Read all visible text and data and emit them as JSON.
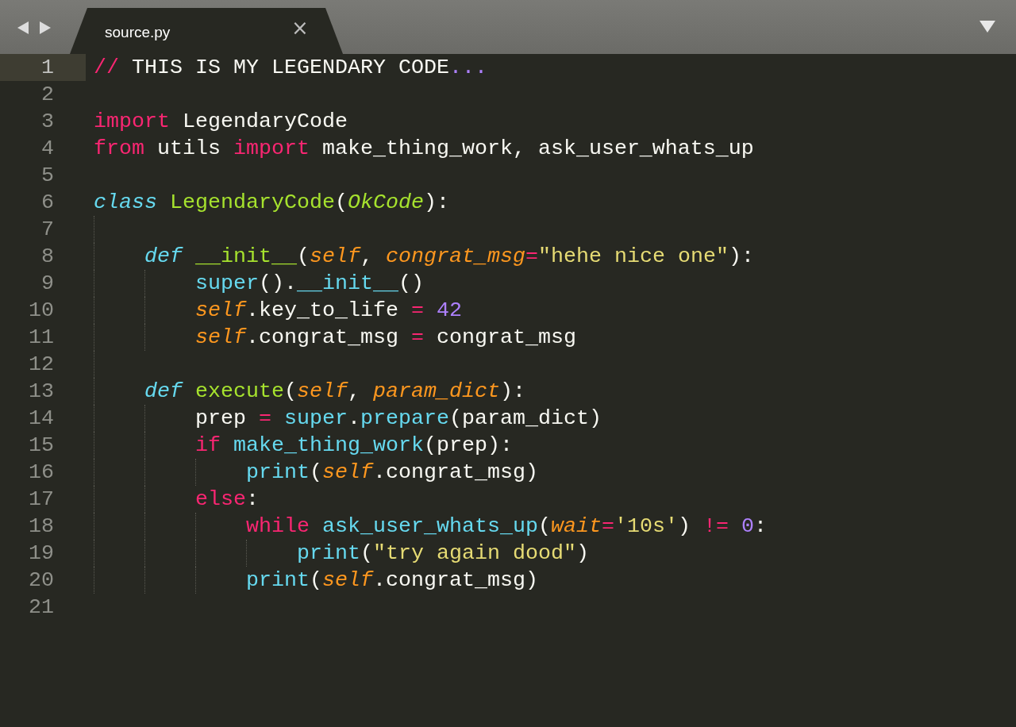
{
  "tab": {
    "title": "source.py",
    "close": "×",
    "selected": true
  },
  "lines": [
    {
      "number": "1",
      "current": true,
      "tokens": [
        {
          "kind": "keyword",
          "text": "//"
        },
        {
          "kind": "plain",
          "text": " THIS IS MY LEGENDARY CODE"
        },
        {
          "kind": "number",
          "text": "..."
        }
      ]
    },
    {
      "number": "2",
      "current": false
    },
    {
      "number": "3",
      "current": false,
      "tokens": [
        {
          "kind": "keyword",
          "text": "import"
        },
        {
          "kind": "plain",
          "text": " LegendaryCode"
        }
      ]
    },
    {
      "number": "4",
      "current": false,
      "tokens": [
        {
          "kind": "keyword",
          "text": "from"
        },
        {
          "kind": "plain",
          "text": " utils "
        },
        {
          "kind": "keyword",
          "text": "import"
        },
        {
          "kind": "plain",
          "text": " make_thing_work, ask_user_whats_up"
        }
      ]
    },
    {
      "number": "5",
      "current": false
    },
    {
      "number": "6",
      "current": false,
      "tokens": [
        {
          "kind": "storage",
          "text": "class "
        },
        {
          "kind": "type",
          "text": "LegendaryCode"
        },
        {
          "kind": "plain",
          "text": "("
        },
        {
          "kind": "inherited",
          "text": "OkCode"
        },
        {
          "kind": "plain",
          "text": "):"
        }
      ],
      "children": [
        {
          "number": "7",
          "current": false
        },
        {
          "number": "8",
          "current": false,
          "tokens": [
            {
              "kind": "storage",
              "text": "def "
            },
            {
              "kind": "type",
              "text": "__init__"
            },
            {
              "kind": "plain",
              "text": "("
            },
            {
              "kind": "param",
              "text": "self"
            },
            {
              "kind": "plain",
              "text": ", "
            },
            {
              "kind": "param",
              "text": "congrat_msg"
            },
            {
              "kind": "operator",
              "text": "="
            },
            {
              "kind": "string",
              "text": "\"hehe nice one\""
            },
            {
              "kind": "plain",
              "text": "):"
            }
          ],
          "children": [
            {
              "number": "9",
              "current": false,
              "tokens": [
                {
                  "kind": "support",
                  "text": "super"
                },
                {
                  "kind": "plain",
                  "text": "()."
                },
                {
                  "kind": "support",
                  "text": "__init__"
                },
                {
                  "kind": "plain",
                  "text": "()"
                }
              ]
            },
            {
              "number": "10",
              "current": false,
              "tokens": [
                {
                  "kind": "param",
                  "text": "self"
                },
                {
                  "kind": "plain",
                  "text": ".key_to_life "
                },
                {
                  "kind": "operator",
                  "text": "= "
                },
                {
                  "kind": "number",
                  "text": "42"
                }
              ]
            },
            {
              "number": "11",
              "current": false,
              "tokens": [
                {
                  "kind": "param",
                  "text": "self"
                },
                {
                  "kind": "plain",
                  "text": ".congrat_msg "
                },
                {
                  "kind": "operator",
                  "text": "="
                },
                {
                  "kind": "plain",
                  "text": " congrat_msg"
                }
              ]
            }
          ]
        },
        {
          "number": "12",
          "current": false
        },
        {
          "number": "13",
          "current": false,
          "tokens": [
            {
              "kind": "storage",
              "text": "def "
            },
            {
              "kind": "type",
              "text": "execute"
            },
            {
              "kind": "plain",
              "text": "("
            },
            {
              "kind": "param",
              "text": "self"
            },
            {
              "kind": "plain",
              "text": ", "
            },
            {
              "kind": "param",
              "text": "param_dict"
            },
            {
              "kind": "plain",
              "text": "):"
            }
          ],
          "children": [
            {
              "number": "14",
              "current": false,
              "tokens": [
                {
                  "kind": "plain",
                  "text": "prep "
                },
                {
                  "kind": "operator",
                  "text": "= "
                },
                {
                  "kind": "support",
                  "text": "super"
                },
                {
                  "kind": "plain",
                  "text": "."
                },
                {
                  "kind": "support",
                  "text": "prepare"
                },
                {
                  "kind": "plain",
                  "text": "(param_dict)"
                }
              ]
            },
            {
              "number": "15",
              "current": false,
              "tokens": [
                {
                  "kind": "keyword",
                  "text": "if "
                },
                {
                  "kind": "support",
                  "text": "make_thing_work"
                },
                {
                  "kind": "plain",
                  "text": "(prep):"
                }
              ],
              "children": [
                {
                  "number": "16",
                  "current": false,
                  "tokens": [
                    {
                      "kind": "support",
                      "text": "print"
                    },
                    {
                      "kind": "plain",
                      "text": "("
                    },
                    {
                      "kind": "param",
                      "text": "self"
                    },
                    {
                      "kind": "plain",
                      "text": ".congrat_msg)"
                    }
                  ]
                }
              ]
            },
            {
              "number": "17",
              "current": false,
              "tokens": [
                {
                  "kind": "keyword",
                  "text": "else"
                },
                {
                  "kind": "plain",
                  "text": ":"
                }
              ],
              "children": [
                {
                  "number": "18",
                  "current": false,
                  "tokens": [
                    {
                      "kind": "keyword",
                      "text": "while "
                    },
                    {
                      "kind": "support",
                      "text": "ask_user_whats_up"
                    },
                    {
                      "kind": "plain",
                      "text": "("
                    },
                    {
                      "kind": "param",
                      "text": "wait"
                    },
                    {
                      "kind": "operator",
                      "text": "="
                    },
                    {
                      "kind": "string",
                      "text": "'10s'"
                    },
                    {
                      "kind": "plain",
                      "text": ") "
                    },
                    {
                      "kind": "operator",
                      "text": "!= "
                    },
                    {
                      "kind": "number",
                      "text": "0"
                    },
                    {
                      "kind": "plain",
                      "text": ":"
                    }
                  ],
                  "children": [
                    {
                      "number": "19",
                      "current": false,
                      "tokens": [
                        {
                          "kind": "support",
                          "text": "print"
                        },
                        {
                          "kind": "plain",
                          "text": "("
                        },
                        {
                          "kind": "string",
                          "text": "\"try again dood\""
                        },
                        {
                          "kind": "plain",
                          "text": ")"
                        }
                      ]
                    }
                  ]
                },
                {
                  "number": "20",
                  "current": false,
                  "tokens": [
                    {
                      "kind": "support",
                      "text": "print"
                    },
                    {
                      "kind": "plain",
                      "text": "("
                    },
                    {
                      "kind": "param",
                      "text": "self"
                    },
                    {
                      "kind": "plain",
                      "text": ".congrat_msg)"
                    }
                  ]
                }
              ]
            }
          ]
        }
      ]
    },
    {
      "number": "21",
      "current": false
    }
  ]
}
